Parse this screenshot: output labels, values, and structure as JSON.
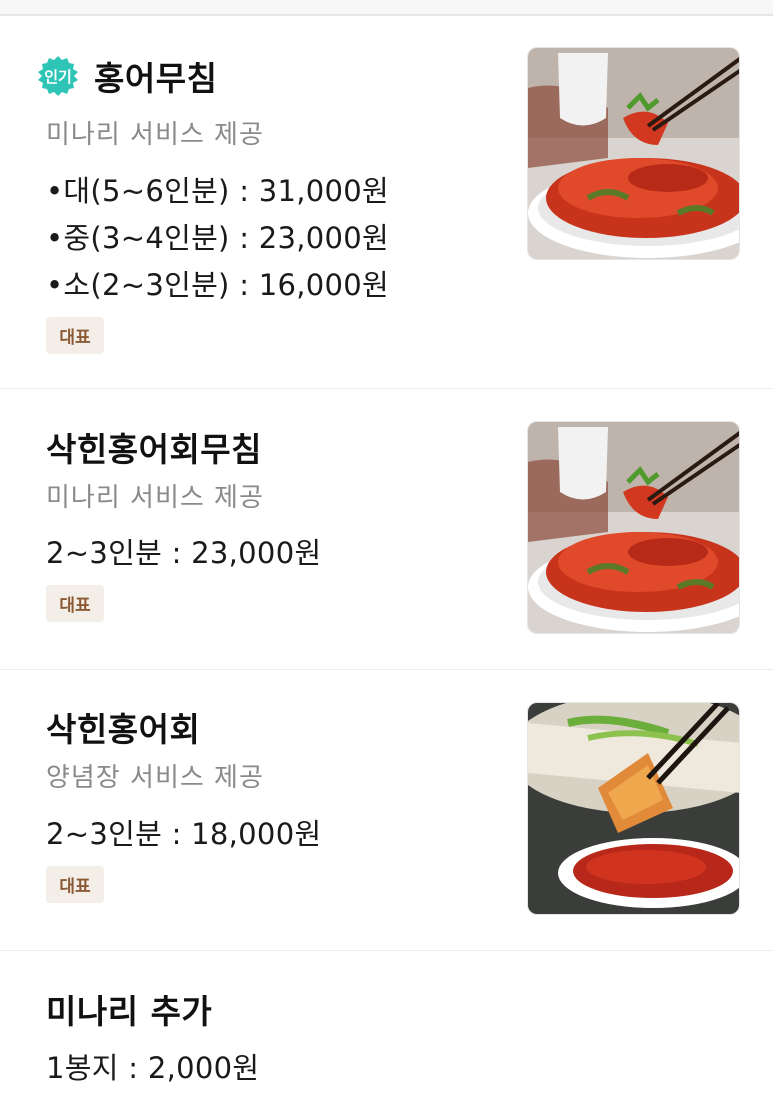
{
  "menu": {
    "items": [
      {
        "badge": "인기",
        "name": "홍어무침",
        "description": "미나리 서비스 제공",
        "prices": [
          "•대(5~6인분) : 31,000원",
          "•중(3~4인분) : 23,000원",
          "•소(2~3인분) : 16,000원"
        ],
        "tag": "대표",
        "image": "spicy-skate-salad-photo"
      },
      {
        "name": "삭힌홍어회무침",
        "description": "미나리 서비스 제공",
        "prices": [
          "2~3인분 : 23,000원"
        ],
        "tag": "대표",
        "image": "spicy-skate-salad-photo"
      },
      {
        "name": "삭힌홍어회",
        "description": "양념장 서비스 제공",
        "prices": [
          "2~3인분 : 18,000원"
        ],
        "tag": "대표",
        "image": "sliced-skate-with-dipping-sauce-photo"
      },
      {
        "name": "미나리 추가",
        "prices": [
          "1봉지 : 2,000원"
        ]
      }
    ]
  },
  "colors": {
    "badge_teal": "#2ec4b6",
    "tag_bg": "#f3eee8",
    "tag_text": "#8b5a35",
    "description_gray": "#8a8a8a"
  }
}
